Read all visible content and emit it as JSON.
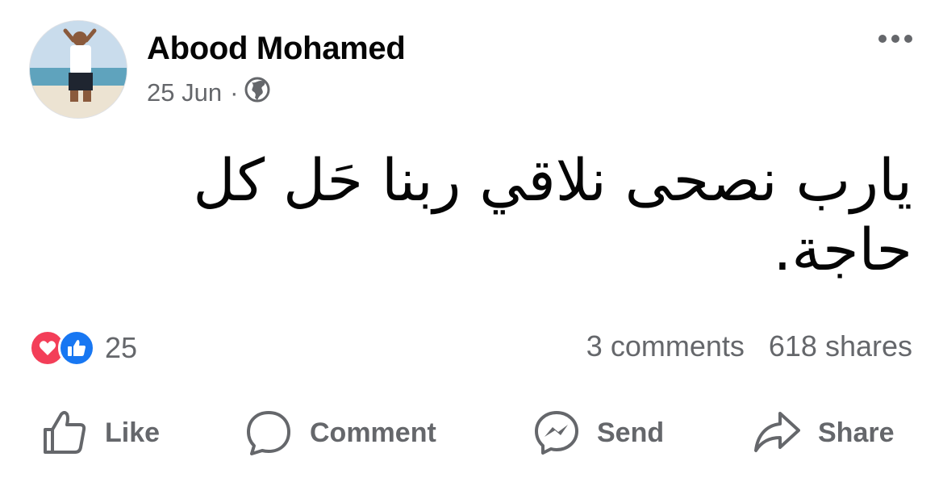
{
  "post": {
    "author": "Abood Mohamed",
    "date": "25 Jun",
    "separator": "·",
    "privacy_icon": "globe-icon",
    "text": "يارب نصحى نلاقي ربنا حَل كل حاجة."
  },
  "reactions": {
    "icons": [
      "heart-icon",
      "thumbs-up-icon"
    ],
    "count": "25"
  },
  "stats": {
    "comments": "3 comments",
    "shares": "618 shares"
  },
  "actions": {
    "like": "Like",
    "comment": "Comment",
    "send": "Send",
    "share": "Share"
  },
  "colors": {
    "text": "#050505",
    "secondary": "#65676b",
    "like_blue": "#1877f2",
    "love_red": "#f33e58"
  }
}
